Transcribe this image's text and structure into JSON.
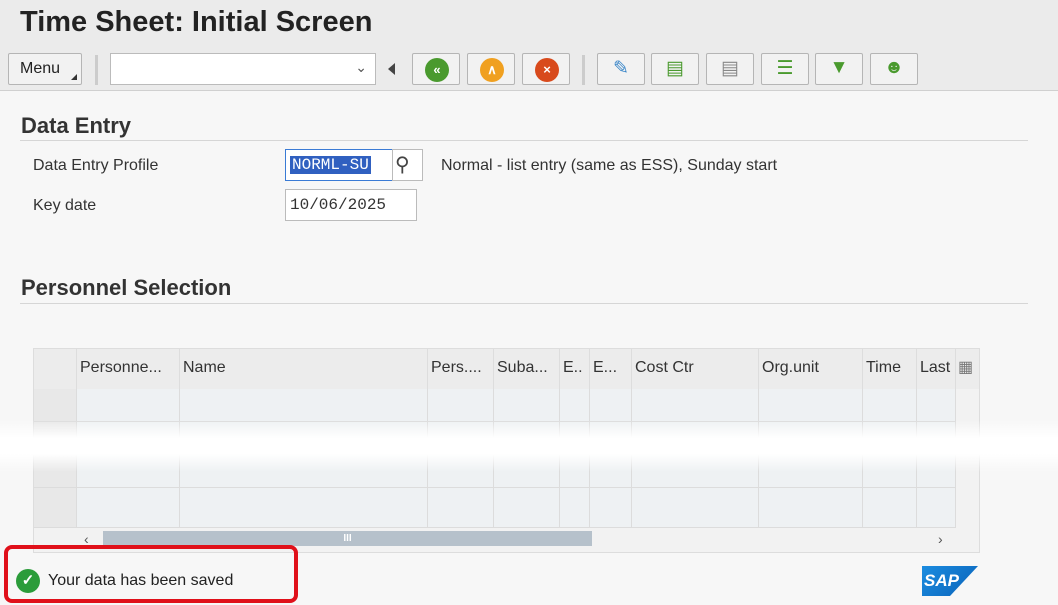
{
  "title": "Time Sheet: Initial Screen",
  "toolbar": {
    "menu_label": "Menu",
    "command_field_value": "",
    "buttons": [
      "back-icon",
      "exit-icon",
      "cancel-icon",
      "edit-icon",
      "enter-times-icon",
      "display-times-icon",
      "release-icon",
      "approve-icon",
      "personnel-icon"
    ]
  },
  "data_entry": {
    "heading": "Data Entry",
    "profile_label": "Data Entry Profile",
    "profile_value": "NORML-SU",
    "profile_desc": "Normal - list entry (same as ESS), Sunday start",
    "keydate_label": "Key date",
    "keydate_value": "10/06/2025"
  },
  "personnel": {
    "heading": "Personnel Selection",
    "columns": [
      "Personne...",
      "Name",
      "Pers....",
      "Suba...",
      "E..",
      "E...",
      "Cost Ctr",
      "Org.unit",
      "Time",
      "Last"
    ],
    "scroll_thumb": "III"
  },
  "status": {
    "message": "Your data has been saved",
    "logo": "SAP"
  }
}
